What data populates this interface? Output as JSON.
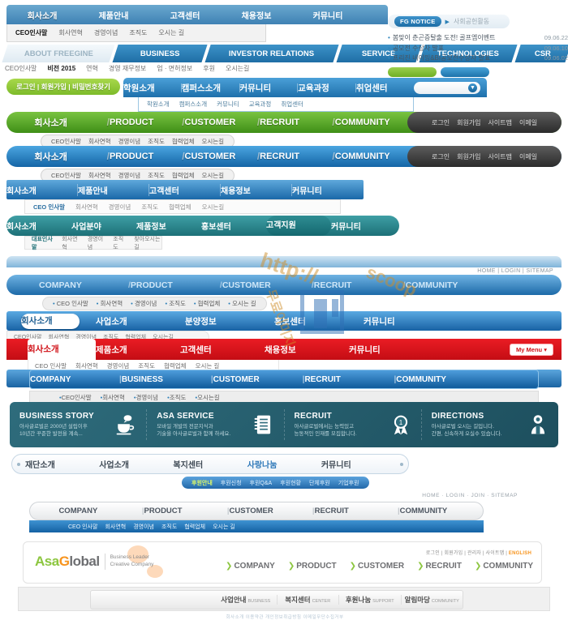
{
  "block1": {
    "tabs": [
      "회사소개",
      "제품안내",
      "고객센터",
      "채용정보",
      "커뮤니티"
    ],
    "sub": [
      "CEO인사말",
      "회사연혁",
      "경영이념",
      "조직도",
      "오시는 길"
    ]
  },
  "block2": {
    "first": "ABOUT FREEGINE",
    "tabs": [
      "BUSINESS",
      "INVESTOR RELATIONS",
      "SERVICE",
      "TECHNOLOGIES",
      "CSR"
    ],
    "sub": [
      "CEO인사말",
      "비전 2015",
      "연혁",
      "경영 재무정보",
      "업 · 면허정보",
      "후원",
      "오시는길"
    ]
  },
  "block3": {
    "tag": "FG NOTICE",
    "arrow": "▶",
    "head_text": "사회공헌활동",
    "notices": [
      {
        "text": "봄맞이 춘곤증탈출 도전! 골프엠이벤트",
        "date": "09.06.22"
      },
      {
        "text": "공모전 수상자 발표",
        "date": "09.06.10"
      },
      {
        "text": "프리진 네이밍&BI공모전수상자 발표",
        "date": "09.06.02"
      }
    ]
  },
  "block4": {
    "label": "로그인  |  회원가입  |  비밀번호찾기"
  },
  "block5": {
    "tabs": [
      "학원소개",
      "캠퍼스소개",
      "커뮤니티",
      "교육과정",
      "취업센터"
    ],
    "sub": [
      "학원소개",
      "캠퍼스소개",
      "커뮤니티",
      "교육과정",
      "취업센터"
    ],
    "select_value": "",
    "select_icon": "▼"
  },
  "block6": {
    "tabs": [
      "회사소개",
      "PRODUCT",
      "CUSTOMER",
      "RECRUIT",
      "COMMUNITY"
    ],
    "utility": [
      "로그인",
      "회원가입",
      "사이트맵",
      "이메일"
    ],
    "sub": [
      "CEO인사말",
      "회사연혁",
      "경영이념",
      "조직도",
      "협력업체",
      "오시는길"
    ]
  },
  "block7": {
    "tabs": [
      "회사소개",
      "PRODUCT",
      "CUSTOMER",
      "RECRUIT",
      "COMMUNITY"
    ],
    "utility": [
      "로그인",
      "회원가입",
      "사이트맵",
      "이메일"
    ],
    "sub": [
      "CEO인사말",
      "회사연혁",
      "경영이념",
      "조직도",
      "협력업체",
      "오시는길"
    ]
  },
  "block8": {
    "tabs": [
      "회사소개",
      "제품안내",
      "고객센터",
      "채용정보",
      "커뮤니티"
    ],
    "sub": [
      "CEO 인사말",
      "회사연혁",
      "경영이념",
      "조직도",
      "협력업체",
      "오시는길"
    ]
  },
  "block9": {
    "tabs": [
      "회사소개",
      "사업분야",
      "제품정보",
      "홍보센터",
      "고객지원",
      "커뮤니티"
    ],
    "sub": [
      "대표인사말",
      "회사연혁",
      "경영이념",
      "조직도",
      "찾아오시는길"
    ]
  },
  "block10": {
    "utility": "HOME  |  LOGIN  |  SITEMAP",
    "tabs": [
      "COMPANY",
      "PRODUCT",
      "CUSTOMER",
      "RECRUIT",
      "COMMUNITY"
    ],
    "sub": [
      "CEO 인사말",
      "회사연혁",
      "경영이념",
      "조직도",
      "협력업체",
      "오시는 길"
    ]
  },
  "block11": {
    "tabs": [
      "회사소개",
      "사업소개",
      "분양정보",
      "홍보센터",
      "커뮤니티"
    ],
    "sub": [
      "CEO인사말",
      "회사연혁",
      "경영이념",
      "조직도",
      "협력업체",
      "오시는길"
    ]
  },
  "block12": {
    "tabs": [
      "회사소개",
      "제품소개",
      "고객센터",
      "채용정보",
      "커뮤니티"
    ],
    "mymenu": "My Menu",
    "mymenu_icon": "▾",
    "sub": [
      "CEO 인사말",
      "회사연혁",
      "경영이념",
      "조직도",
      "협력업체",
      "오시는 길"
    ]
  },
  "block13": {
    "tabs": [
      "COMPANY",
      "BUSINESS",
      "CUSTOMER",
      "RECRUIT",
      "COMMUNITY"
    ],
    "pipe": "|",
    "sub": [
      "CEO인사말",
      "회사연혁",
      "경영이념",
      "조직도",
      "오시는길"
    ]
  },
  "block14": {
    "cells": [
      {
        "title": "BUSINESS STORY",
        "desc1": "아사글로벌은 2000년 설립이후",
        "desc2": "10년간 꾸준한 발전을 계속...",
        "icon": "coffee-cup-icon"
      },
      {
        "title": "ASA SERVICE",
        "desc1": "모바일 개발의 전문지식과",
        "desc2": "기술을 아사글로벌과 함께 하세요.",
        "icon": "document-list-icon"
      },
      {
        "title": "RECRUIT",
        "desc1": "아사글로벌에서는 능력있고",
        "desc2": "능동적인 인재를 모집합니다.",
        "icon": "award-ribbon-icon"
      },
      {
        "title": "DIRECTIONS",
        "desc1": "아사글로벌 오시는 길입니다.",
        "desc2": "간편, 신속하게 오실수 있습니다.",
        "icon": "person-pin-icon"
      }
    ]
  },
  "block15": {
    "tabs": [
      "재단소개",
      "사업소개",
      "복지센터",
      "사랑나눔",
      "커뮤니티"
    ],
    "sub": [
      "후원안내",
      "후원신청",
      "후원Q&A",
      "후원현황",
      "단체후원",
      "기업후원"
    ]
  },
  "block16": {
    "utility": "HOME  ·  LOGIN  ·  JOIN  ·  SITEMAP",
    "tabs": [
      "COMPANY",
      "PRODUCT",
      "CUSTOMER",
      "RECRUIT",
      "COMMUNITY"
    ],
    "pipe": "|",
    "sub": [
      "CEO 인사말",
      "회사연혁",
      "경영이념",
      "조직도",
      "협력업체",
      "오시는 길"
    ]
  },
  "block17": {
    "logo_asa": "Asa",
    "logo_g": "G",
    "logo_lobal": "lobal",
    "tagline1": "Business Leader",
    "tagline2": "Creative Company",
    "utility": [
      "로그인",
      "회원가입",
      "관리자",
      "사이트맵"
    ],
    "utility_en": "ENGLISH",
    "nav": [
      "COMPANY",
      "PRODUCT",
      "CUSTOMER",
      "RECRUIT",
      "COMMUNITY"
    ],
    "nav_arrow": "❯"
  },
  "block18": {
    "cells": [
      {
        "ko": "",
        "en": ""
      },
      {
        "ko": "",
        "en": ""
      },
      {
        "ko": "사업안내",
        "en": "BUSINESS"
      },
      {
        "ko": "복지센터",
        "en": "CENTER"
      },
      {
        "ko": "후원나눔",
        "en": "SUPPORT"
      },
      {
        "ko": "알림마당",
        "en": "COMMUNITY"
      }
    ],
    "footer": "회사소개  이용약관   개인정보취급방침   이메일무단수집거부"
  },
  "watermark": {
    "line1": "http://",
    "line2": "scoop",
    "line3": "무료이미지"
  },
  "colors": {
    "blue": "#1d6aa8",
    "green": "#3f8f17",
    "teal": "#1c7077",
    "red": "#c40d14",
    "orange": "#f7941e",
    "lime": "#8cc63f"
  }
}
